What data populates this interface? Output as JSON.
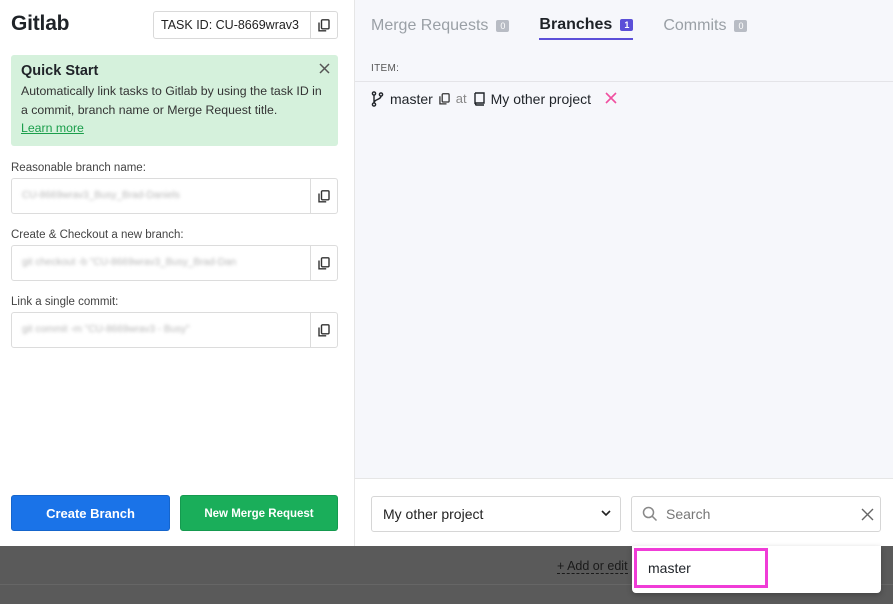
{
  "app_title": "Gitlab",
  "task_id": "TASK ID: CU-8669wrav3",
  "quick_start": {
    "title": "Quick Start",
    "body": "Automatically link tasks to Gitlab by using the task ID in a commit, branch name or Merge Request title.",
    "link": "Learn more"
  },
  "fields": [
    {
      "label": "Reasonable branch name:",
      "value": "CU-8669wrav3_Busy_Brad-Daniels"
    },
    {
      "label": "Create & Checkout a new branch:",
      "value": "git checkout -b \"CU-8669wrav3_Busy_Brad-Dan"
    },
    {
      "label": "Link a single commit:",
      "value": "git commit -m \"CU-8669wrav3 - Busy\""
    }
  ],
  "buttons": {
    "create_branch": "Create Branch",
    "new_merge_request": "New Merge Request"
  },
  "tabs": [
    {
      "label": "Merge Requests",
      "count": "0",
      "active": false
    },
    {
      "label": "Branches",
      "count": "1",
      "active": true
    },
    {
      "label": "Commits",
      "count": "0",
      "active": false
    }
  ],
  "item_header": "ITEM:",
  "item": {
    "branch": "master",
    "at": "at",
    "project": "My other project"
  },
  "project_select": {
    "selected": "My other project"
  },
  "search": {
    "placeholder": "Search"
  },
  "add_edit": "+ Add or edit",
  "dropdown": {
    "option": "master"
  },
  "colors": {
    "primary": "#1a73e8",
    "success": "#1aae5a",
    "accent": "#5b4fd8",
    "highlight": "#f03cd7",
    "danger": "#f04fa0"
  }
}
